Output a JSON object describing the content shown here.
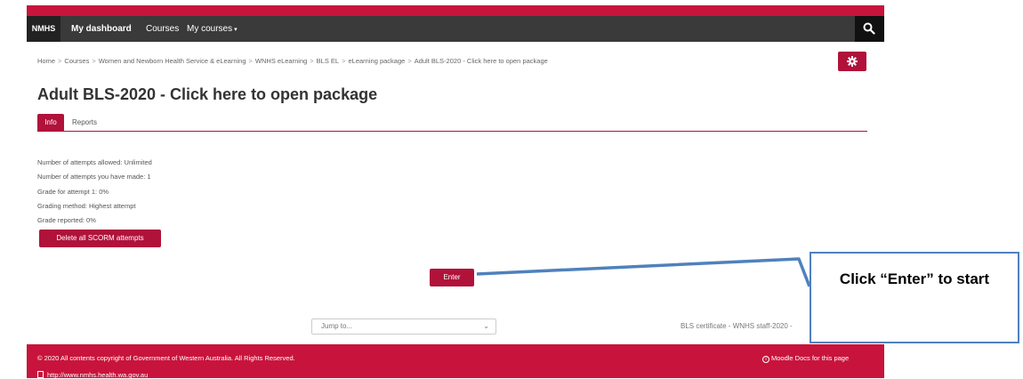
{
  "navbar": {
    "brand": "NMHS",
    "dashboard": "My dashboard",
    "courses": "Courses",
    "my_courses": "My courses",
    "my_courses_caret": "▾"
  },
  "breadcrumb": {
    "items": [
      "Home",
      "Courses",
      "Women and Newborn Health Service & eLearning",
      "WNHS eLearning",
      "BLS EL",
      "eLearning package",
      "Adult BLS-2020 - Click here to open package"
    ],
    "separator": ">"
  },
  "page": {
    "title": "Adult BLS-2020 - Click here to open package"
  },
  "tabs": {
    "info": "Info",
    "reports": "Reports"
  },
  "info_lines": [
    "Number of attempts allowed: Unlimited",
    "Number of attempts you have made: 1",
    "Grade for attempt 1: 0%",
    "Grading method: Highest attempt",
    "Grade reported: 0%"
  ],
  "buttons": {
    "delete_attempts": "Delete all SCORM attempts",
    "enter": "Enter"
  },
  "jump": {
    "label": "Jump to...",
    "chevron": "⌄"
  },
  "next_activity": "BLS certificate - WNHS staff-2020 -",
  "footer": {
    "copyright": "© 2020 All contents copyright of Government of Western Australia. All Rights Reserved.",
    "docs": "Moodle Docs for this page",
    "docs_icon_char": "i",
    "url": "http://www.nmhs.health.wa.gov.au"
  },
  "callout": {
    "text": "Click “Enter” to start"
  },
  "colors": {
    "brand": "#c8143c",
    "button": "#b0123a",
    "navbar": "#3a3a3a",
    "callout_border": "#4f81bd"
  },
  "icons": {
    "search": "search-icon",
    "settings": "gear-icon",
    "dropdown": "chevron-down-icon",
    "info": "info-icon",
    "bookmark": "bookmark-icon"
  }
}
